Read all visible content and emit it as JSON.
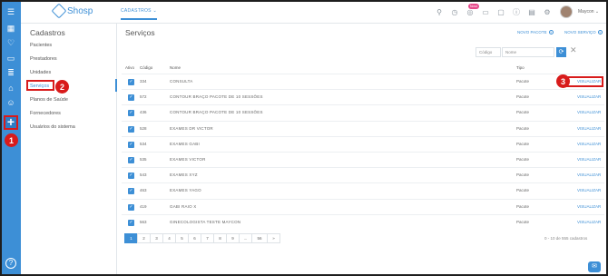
{
  "header": {
    "logo_text": "Shosp",
    "module_tab": "CADASTROS",
    "notification_badge": "Novo",
    "user_name": "Maycon"
  },
  "sidebar": {
    "title": "Cadastros",
    "items": [
      {
        "label": "Pacientes"
      },
      {
        "label": "Prestadores"
      },
      {
        "label": "Unidades"
      },
      {
        "label": "Serviços"
      },
      {
        "label": "Planos de Saúde"
      },
      {
        "label": "Fornecedores"
      },
      {
        "label": "Usuários do sistema"
      }
    ]
  },
  "main": {
    "title": "Serviços",
    "new_package": "NOVO PACOTE",
    "new_service": "NOVO SERVIÇO",
    "filter": {
      "code_placeholder": "Código",
      "name_placeholder": "Nome"
    },
    "columns": {
      "active": "Ativo",
      "code": "Código",
      "name": "Nome",
      "type": "Tipo"
    },
    "rows": [
      {
        "code": "334",
        "name": "CONSULTA",
        "type": "Pacote",
        "action": "VISUALIZAR"
      },
      {
        "code": "572",
        "name": "CONTOUR BRAÇO PACOTE DE 10 SESSÕES",
        "type": "Pacote",
        "action": "VISUALIZAR"
      },
      {
        "code": "436",
        "name": "CONTOUR BRAÇO PACOTE DE 10 SESSÕES",
        "type": "Pacote",
        "action": "VISUALIZAR"
      },
      {
        "code": "528",
        "name": "EXAMES DR VICTOR",
        "type": "Pacote",
        "action": "VISUALIZAR"
      },
      {
        "code": "534",
        "name": "EXAMES GABI",
        "type": "Pacote",
        "action": "VISUALIZAR"
      },
      {
        "code": "535",
        "name": "EXAMES VICTOR",
        "type": "Pacote",
        "action": "VISUALIZAR"
      },
      {
        "code": "543",
        "name": "EXAMES XYZ",
        "type": "Pacote",
        "action": "VISUALIZAR"
      },
      {
        "code": "463",
        "name": "EXAMES YAGO",
        "type": "Pacote",
        "action": "VISUALIZAR"
      },
      {
        "code": "419",
        "name": "GABI RAIO X",
        "type": "Pacote",
        "action": "VISUALIZAR"
      },
      {
        "code": "563",
        "name": "GINECOLOGISTA TESTE MAYCON",
        "type": "Pacote",
        "action": "VISUALIZAR"
      }
    ],
    "pagination": [
      "1",
      "2",
      "3",
      "4",
      "5",
      "6",
      "7",
      "8",
      "9",
      "...",
      "56",
      "»"
    ],
    "count": "0 - 10 de 555 cadastros"
  },
  "steps": [
    "1",
    "2",
    "3"
  ],
  "colors": {
    "primary": "#3d8fd6",
    "highlight": "#d81b1b"
  }
}
